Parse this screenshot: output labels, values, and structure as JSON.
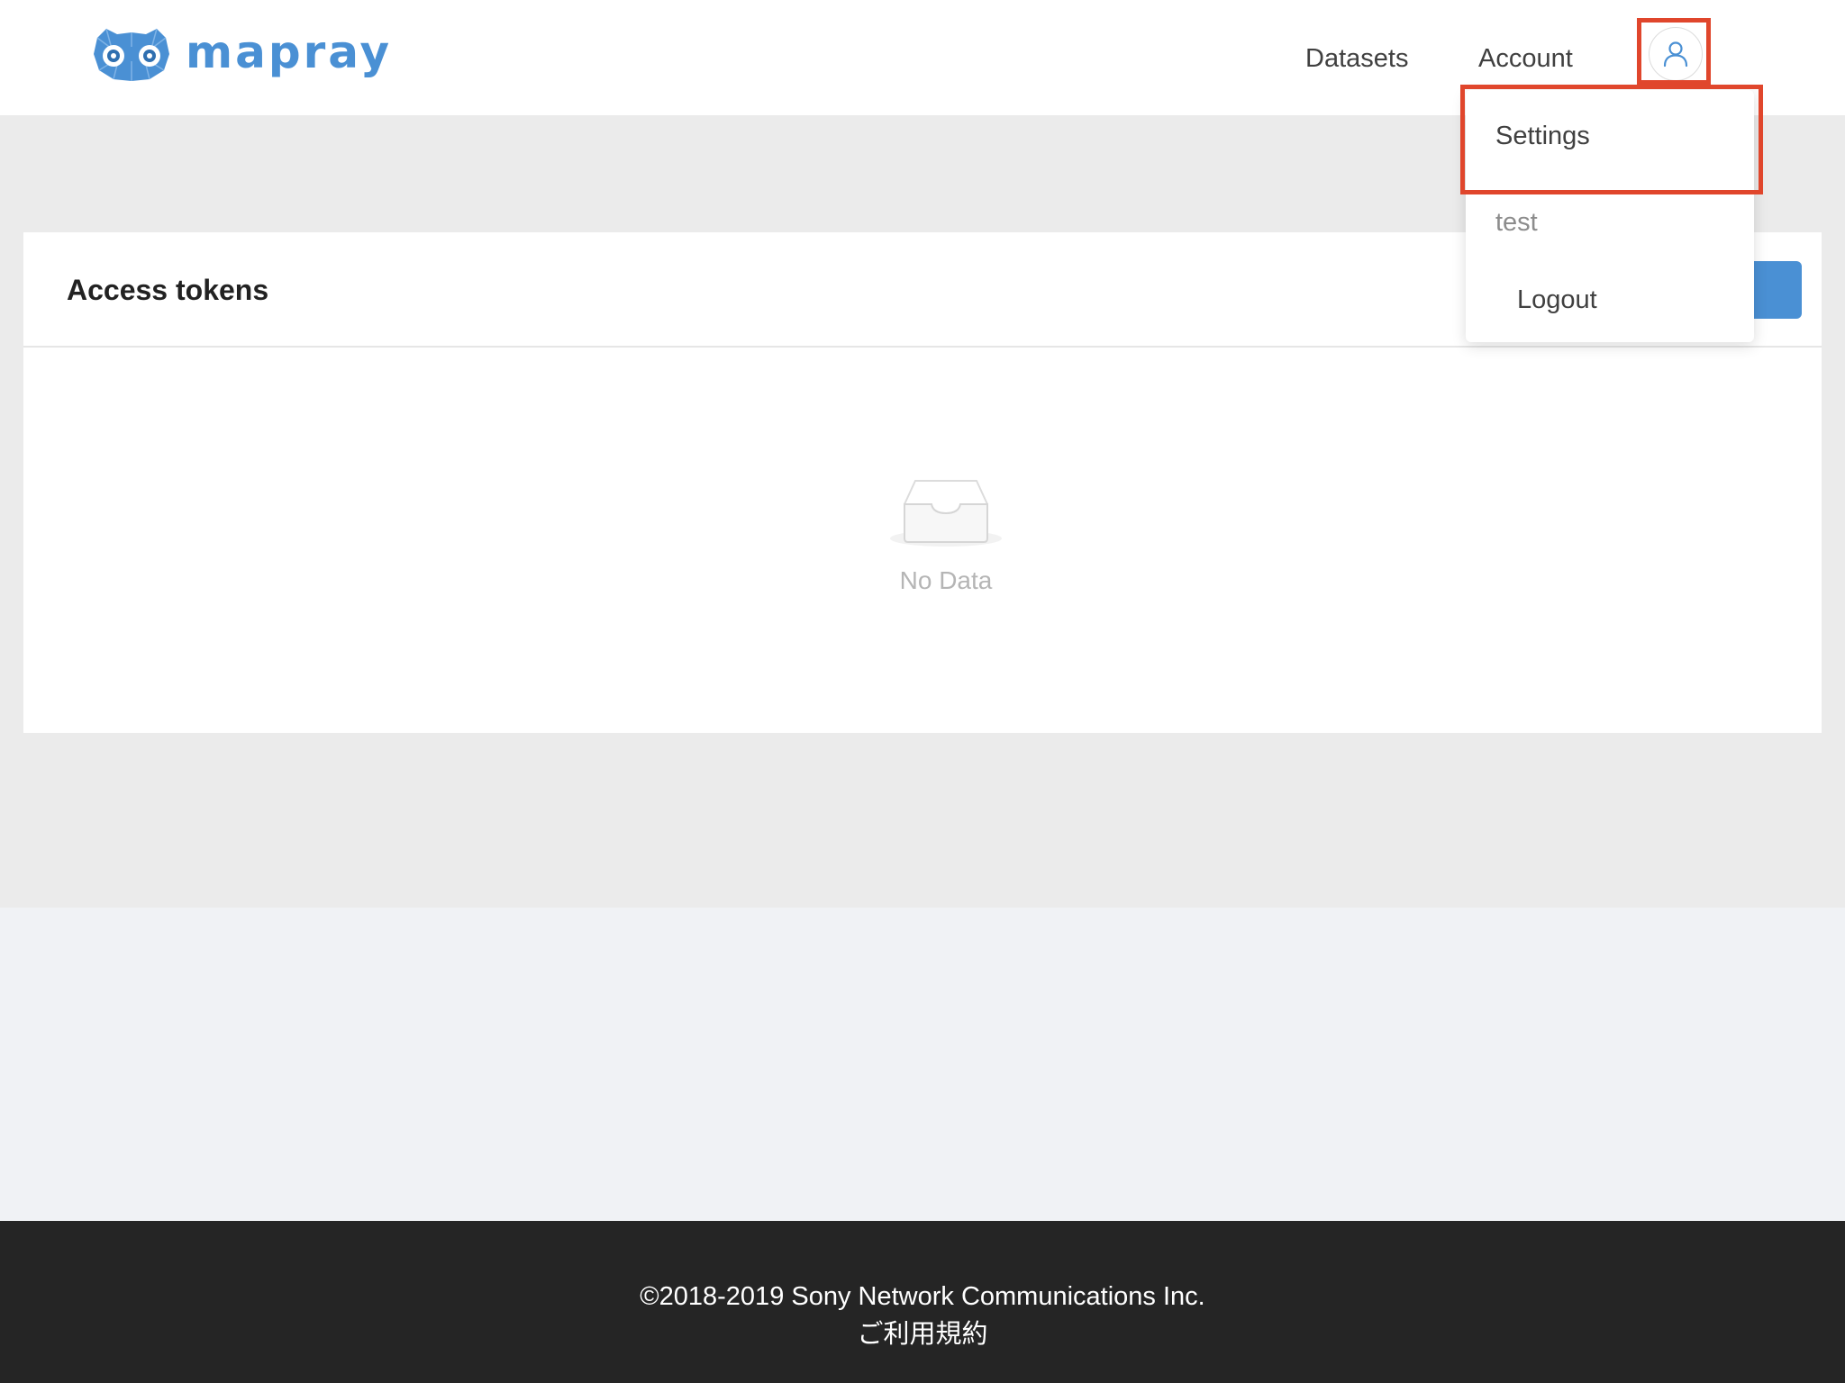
{
  "header": {
    "logo_text": "mapray",
    "nav": {
      "datasets": "Datasets",
      "account": "Account"
    },
    "user_icon": "user-icon"
  },
  "user_menu": {
    "settings": "Settings",
    "username": "test",
    "logout": "Logout"
  },
  "main": {
    "card_title": "Access tokens",
    "empty_text": "No Data",
    "empty_icon": "inbox-icon"
  },
  "footer": {
    "copyright": "©2018-2019 Sony Network Communications Inc.",
    "terms": "ご利用規約"
  },
  "colors": {
    "brand": "#4a90d4",
    "annotation": "#e0462c",
    "footer_bg": "#252525",
    "content_bg": "#ebebeb",
    "page_bg": "#f0f2f5"
  }
}
